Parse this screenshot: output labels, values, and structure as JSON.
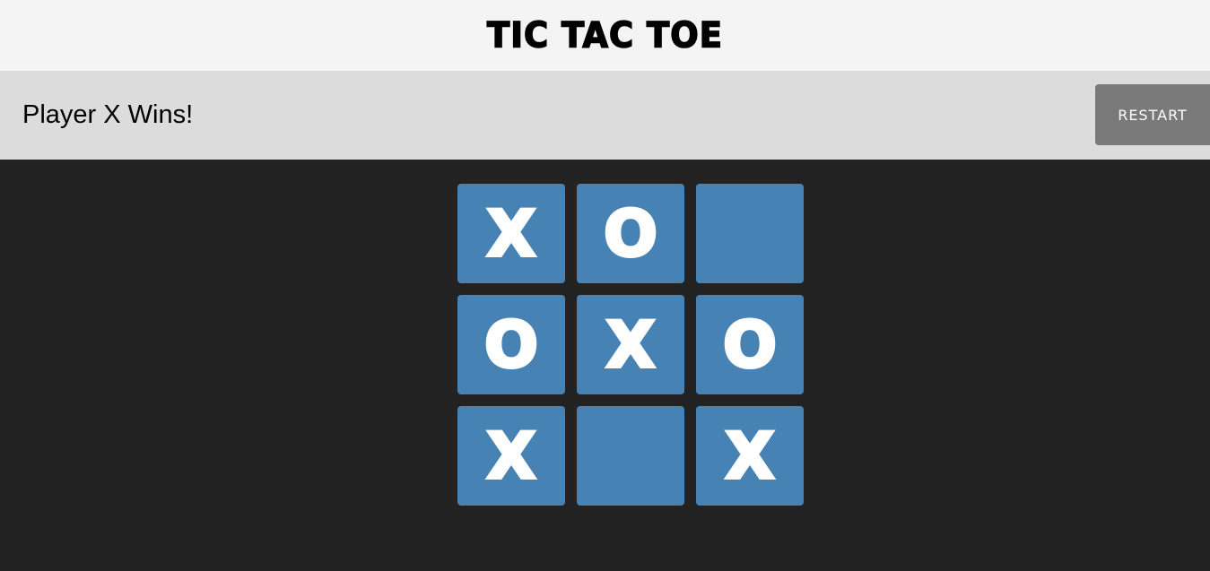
{
  "header": {
    "title": "TIC TAC TOE"
  },
  "status": {
    "message": "Player X Wins!",
    "restart_label": "RESTART"
  },
  "colors": {
    "background": "#222222",
    "header_bg": "#f4f4f4",
    "status_bg": "#dcdcdc",
    "button_bg": "#7a7a7a",
    "cell_bg": "#4682b4",
    "mark": "#ffffff"
  },
  "board": {
    "cells": [
      "X",
      "O",
      "",
      "O",
      "X",
      "O",
      "X",
      "",
      "X"
    ]
  }
}
